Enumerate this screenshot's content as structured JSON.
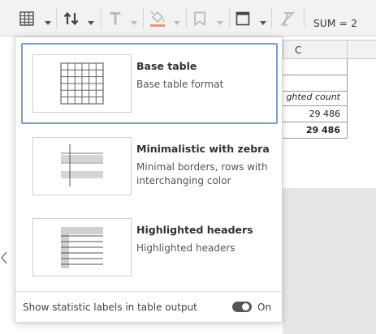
{
  "toolbar": {
    "sum_label": "SUM = 2",
    "icons": [
      "table-style-icon",
      "sort-icon",
      "text-style-icon",
      "fill-color-icon",
      "bookmark-icon",
      "border-icon",
      "clear-format-icon"
    ],
    "fill_color_accent": "#e8967a"
  },
  "sheet": {
    "column_c_header": "C",
    "cells": [
      "",
      "",
      "ghted count",
      "29 486",
      "29 486"
    ]
  },
  "popup": {
    "options": [
      {
        "title": "Base table",
        "description": "Base table format"
      },
      {
        "title": "Minimalistic with zebra",
        "description": "Minimal borders, rows with interchanging color"
      },
      {
        "title": "Highlighted headers",
        "description": "Highlighted headers"
      }
    ],
    "selected_index": 0,
    "selected_border_color": "#7b9fd6",
    "footer": {
      "label": "Show statistic labels in table output",
      "toggle_state": "On"
    }
  }
}
